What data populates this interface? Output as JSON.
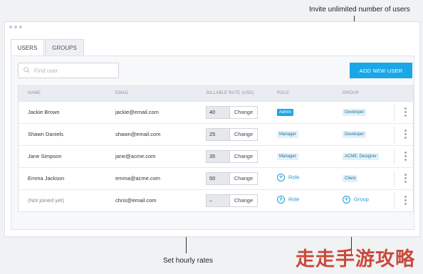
{
  "annotations": {
    "top": "Invite unlimited number of users",
    "bottom": "Set hourly rates"
  },
  "tabs": [
    {
      "label": "USERS",
      "active": true
    },
    {
      "label": "GROUPS",
      "active": false
    }
  ],
  "search": {
    "placeholder": "Find user"
  },
  "add_user_label": "ADD NEW USER",
  "columns": [
    "NAME",
    "EMAIL",
    "BILLABLE RATE (USD)",
    "ROLE",
    "GROUP"
  ],
  "rows": [
    {
      "name": "Jackie Brown",
      "email": "jackie@email.com",
      "rate": "40",
      "change": "Change",
      "role": "Admin",
      "group": "Developer"
    },
    {
      "name": "Shawn Daniels",
      "email": "shawn@email.com",
      "rate": "25",
      "change": "Change",
      "role": "Manager",
      "group": "Developer"
    },
    {
      "name": "Jane Simpson",
      "email": "jane@acme.com",
      "rate": "35",
      "change": "Change",
      "role": "Manager",
      "group": "ACME, Designer"
    },
    {
      "name": "Emma Jackson",
      "email": "emma@acme.com",
      "rate": "50",
      "change": "Change",
      "role_action": "Role",
      "group": "Client"
    },
    {
      "name": "(Not joined yet)",
      "email": "chris@email.com",
      "rate": "–",
      "change": "Change",
      "role_action": "Role",
      "group_action": "Group"
    }
  ],
  "colors": {
    "accent": "#19a7e8",
    "badge_bg": "#dff1fa",
    "header_bg": "#e9ecf0"
  },
  "watermark": "走走手游攻略"
}
